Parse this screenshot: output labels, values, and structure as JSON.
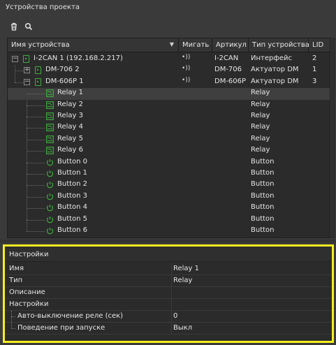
{
  "panel": {
    "title": "Устройства проекта"
  },
  "toolbar": {
    "delete_icon": "trash-icon",
    "search_icon": "search-icon"
  },
  "table": {
    "columns": [
      "Имя устройства",
      "Мигать",
      "Артикул",
      "Тип устройства",
      "LID"
    ],
    "rows": [
      {
        "name": "I-2CAN 1 (192.168.2.217)",
        "blink": "•))",
        "article": "I-2CAN",
        "type": "Интерфейс",
        "lid": "2",
        "kind": "device",
        "expander": "−"
      },
      {
        "name": "DM-706 2",
        "blink": "•))",
        "article": "DM-706",
        "type": "Актуатор DM",
        "lid": "1",
        "kind": "device",
        "expander": "+"
      },
      {
        "name": "DM-606P 1",
        "blink": "•))",
        "article": "DM-606P",
        "type": "Актуатор DM",
        "lid": "3",
        "kind": "device",
        "expander": "−"
      },
      {
        "name": "Relay 1",
        "type": "Relay",
        "kind": "relay"
      },
      {
        "name": "Relay 2",
        "type": "Relay",
        "kind": "relay"
      },
      {
        "name": "Relay 3",
        "type": "Relay",
        "kind": "relay"
      },
      {
        "name": "Relay 4",
        "type": "Relay",
        "kind": "relay"
      },
      {
        "name": "Relay 5",
        "type": "Relay",
        "kind": "relay"
      },
      {
        "name": "Relay 6",
        "type": "Relay",
        "kind": "relay"
      },
      {
        "name": "Button 0",
        "type": "Button",
        "kind": "button"
      },
      {
        "name": "Button 1",
        "type": "Button",
        "kind": "button"
      },
      {
        "name": "Button 2",
        "type": "Button",
        "kind": "button"
      },
      {
        "name": "Button 3",
        "type": "Button",
        "kind": "button"
      },
      {
        "name": "Button 4",
        "type": "Button",
        "kind": "button"
      },
      {
        "name": "Button 5",
        "type": "Button",
        "kind": "button"
      },
      {
        "name": "Button 6",
        "type": "Button",
        "kind": "button"
      }
    ]
  },
  "settings": {
    "title": "Настройки",
    "props": [
      {
        "name": "Имя",
        "value": "Relay 1"
      },
      {
        "name": "Тип",
        "value": "Relay"
      },
      {
        "name": "Описание",
        "value": ""
      },
      {
        "name": "Настройки",
        "value": ""
      },
      {
        "name": "Авто-выключение реле (сек)",
        "value": "0"
      },
      {
        "name": "Поведение при запуске",
        "value": "Выкл"
      }
    ]
  },
  "colors": {
    "accent_highlight": "#f5ee20",
    "device_icon": "#3fae3f"
  }
}
